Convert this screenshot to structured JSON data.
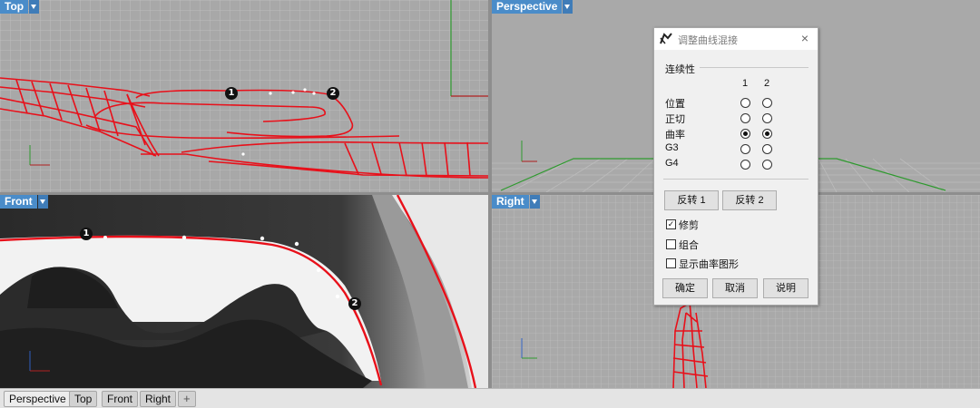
{
  "viewports": {
    "top": {
      "label": "Top"
    },
    "perspective": {
      "label": "Perspective"
    },
    "front": {
      "label": "Front"
    },
    "right": {
      "label": "Right"
    }
  },
  "curve_points": {
    "start": "1",
    "end": "2"
  },
  "tabs": [
    "Perspective",
    "Top",
    "Front",
    "Right"
  ],
  "tab_add": "+",
  "dialog": {
    "title": "调整曲线混接",
    "close": "×",
    "continuity_section": "连续性",
    "column_headers": [
      "1",
      "2"
    ],
    "rows": [
      {
        "label": "位置",
        "end1": false,
        "end2": false
      },
      {
        "label": "正切",
        "end1": false,
        "end2": false
      },
      {
        "label": "曲率",
        "end1": true,
        "end2": true
      },
      {
        "label": "G3",
        "end1": false,
        "end2": false
      },
      {
        "label": "G4",
        "end1": false,
        "end2": false
      }
    ],
    "reverse1": "反转 1",
    "reverse2": "反转 2",
    "options": [
      {
        "label": "修剪",
        "checked": true
      },
      {
        "label": "组合",
        "checked": false
      },
      {
        "label": "显示曲率图形",
        "checked": false
      }
    ],
    "ok": "确定",
    "cancel": "取消",
    "help": "说明"
  },
  "colors": {
    "viewport_label": "#4a8cc9",
    "curve": "#e8101a",
    "grid": "#bdbdbd",
    "viewport_bg": "#a9a9a9"
  }
}
